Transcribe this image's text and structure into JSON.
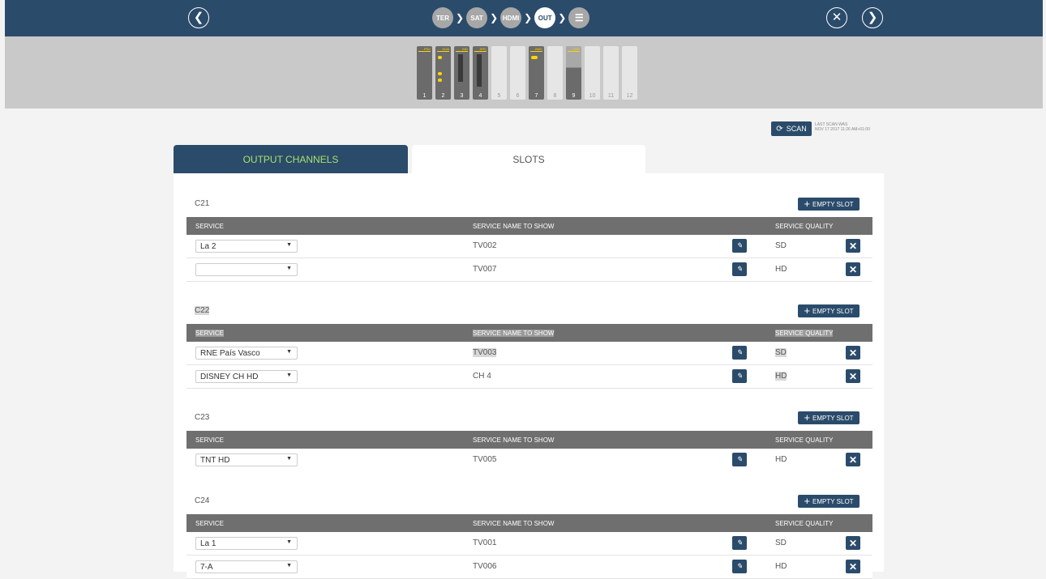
{
  "topbar": {
    "steps": [
      {
        "label": "TER",
        "active": false
      },
      {
        "label": "SAT",
        "active": false
      },
      {
        "label": "HDMI",
        "active": false
      },
      {
        "label": "OUT",
        "active": true
      }
    ]
  },
  "slots": [
    {
      "num": "1",
      "tag": "PSU"
    },
    {
      "num": "2",
      "tag": "HUB"
    },
    {
      "num": "3",
      "tag": "IND"
    },
    {
      "num": "4",
      "tag": "SRC"
    },
    {
      "num": "5",
      "tag": ""
    },
    {
      "num": "6",
      "tag": ""
    },
    {
      "num": "7",
      "tag": "BMC"
    },
    {
      "num": "8",
      "tag": ""
    },
    {
      "num": "9",
      "tag": "OUT"
    },
    {
      "num": "10",
      "tag": ""
    },
    {
      "num": "11",
      "tag": ""
    },
    {
      "num": "12",
      "tag": ""
    }
  ],
  "scan": {
    "label": "SCAN",
    "info_label": "LAST SCAN WAS",
    "info_date": "NOV 17 2017 11:26 AM+01:00"
  },
  "tabs": {
    "output": "OUTPUT CHANNELS",
    "slots": "SLOTS"
  },
  "table_headers": {
    "service": "SERVICE",
    "name": "SERVICE NAME TO SHOW",
    "quality": "SERVICE QUALITY"
  },
  "empty_slot_label": "EMPTY SLOT",
  "channels": [
    {
      "title": "C21",
      "rows": [
        {
          "service": "La 2",
          "name": "TV002",
          "quality": "SD"
        },
        {
          "service": "",
          "name": "TV007",
          "quality": "HD"
        }
      ]
    },
    {
      "title": "C22",
      "rows": [
        {
          "service": "RNE País Vasco",
          "name": "TV003",
          "quality": "SD"
        },
        {
          "service": "DISNEY CH HD",
          "name": "CH 4",
          "quality": "HD"
        }
      ]
    },
    {
      "title": "C23",
      "rows": [
        {
          "service": "TNT HD",
          "name": "TV005",
          "quality": "HD"
        }
      ]
    },
    {
      "title": "C24",
      "rows": [
        {
          "service": "La 1",
          "name": "TV001",
          "quality": "SD"
        },
        {
          "service": "7-A",
          "name": "TV006",
          "quality": "HD"
        }
      ]
    }
  ]
}
